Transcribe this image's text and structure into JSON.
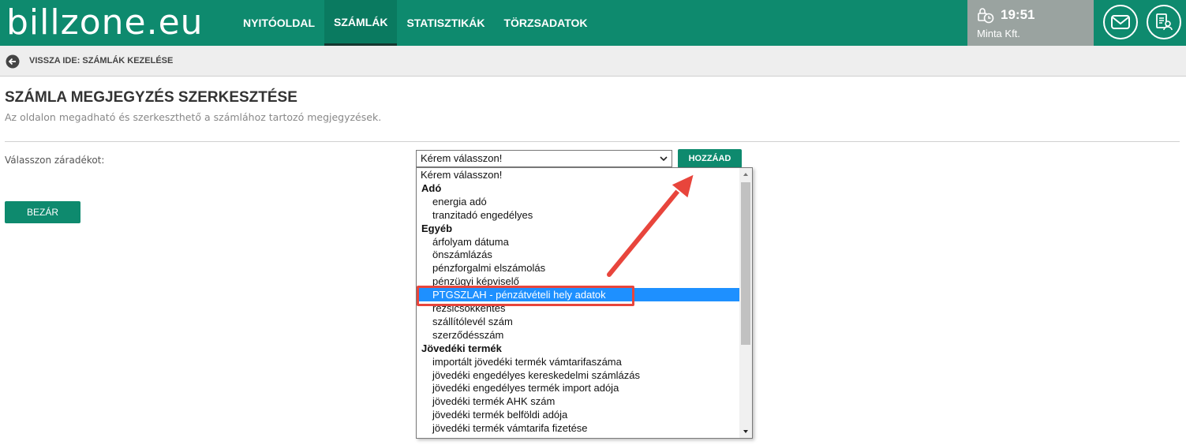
{
  "header": {
    "logo": "billzone.eu",
    "nav": [
      "NYITÓOLDAL",
      "SZÁMLÁK",
      "STATISZTIKÁK",
      "TÖRZSADATOK"
    ],
    "active_nav": "SZÁMLÁK",
    "time": "19:51",
    "company": "Minta Kft."
  },
  "subbar": {
    "back_label": "VISSZA IDE: SZÁMLÁK KEZELÉSE"
  },
  "page": {
    "title": "SZÁMLA MEGJEGYZÉS SZERKESZTÉSE",
    "description": "Az oldalon megadható és szerkeszthető a számlához tartozó megjegyzések.",
    "field_label": "Válasszon záradékot:",
    "select_value": "Kérem válasszon!",
    "add_button": "HOZZÁAD",
    "close_button": "BEZÁR"
  },
  "dropdown": {
    "options": [
      {
        "text": "Kérem válasszon!",
        "kind": "first"
      },
      {
        "text": "Adó",
        "kind": "group"
      },
      {
        "text": "energia adó",
        "kind": "child"
      },
      {
        "text": "tranzitadó engedélyes",
        "kind": "child"
      },
      {
        "text": "Egyéb",
        "kind": "group"
      },
      {
        "text": "árfolyam dátuma",
        "kind": "child"
      },
      {
        "text": "önszámlázás",
        "kind": "child"
      },
      {
        "text": "pénzforgalmi elszámolás",
        "kind": "child"
      },
      {
        "text": "pénzügyi képviselő",
        "kind": "child"
      },
      {
        "text": "PTGSZLAH - pénzátvételi hely adatok",
        "kind": "child",
        "selected": true
      },
      {
        "text": "rezsicsökkentés",
        "kind": "child"
      },
      {
        "text": "szállítólevél szám",
        "kind": "child"
      },
      {
        "text": "szerződésszám",
        "kind": "child"
      },
      {
        "text": "Jövedéki termék",
        "kind": "group"
      },
      {
        "text": "importált jövedéki termék vámtarifaszáma",
        "kind": "child"
      },
      {
        "text": "jövedéki engedélyes kereskedelmi számlázás",
        "kind": "child"
      },
      {
        "text": "jövedéki engedélyes termék import adója",
        "kind": "child"
      },
      {
        "text": "jövedéki termék AHK szám",
        "kind": "child"
      },
      {
        "text": "jövedéki termék belföldi adója",
        "kind": "child"
      },
      {
        "text": "jövedéki termék vámtarifa fizetése",
        "kind": "child"
      }
    ]
  },
  "colors": {
    "brand": "#0e8a6e",
    "selected": "#1e90ff",
    "annotation": "#e8453c"
  }
}
